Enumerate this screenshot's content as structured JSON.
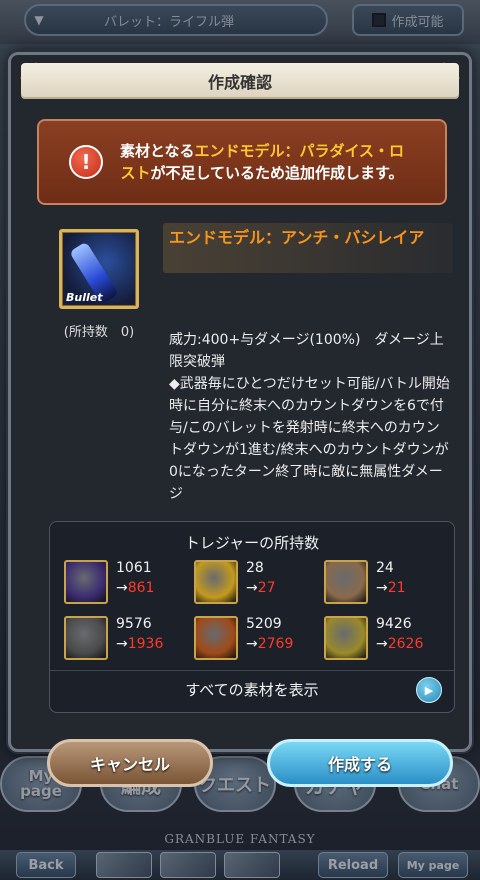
{
  "header": {
    "pallet_label": "バレット：ライフル弾",
    "craftable_label": "作成可能"
  },
  "dialog": {
    "title": "作成確認",
    "warning": {
      "prefix": "素材となる",
      "highlight": "エンドモデル：パラダイス・ロスト",
      "suffix": "が不足しているため追加作成します。"
    },
    "item": {
      "name": "エンドモデル：アンチ・バシレイア",
      "tag": "Bullet",
      "owned_label": "(所持数　0)",
      "description": "威力:400+与ダメージ(100%)　ダメージ上限突破弾\n◆武器毎にひとつだけセット可能/バトル開始時に自分に終末へのカウントダウンを6で付与/このバレットを発射時に終末へのカウントダウンが1進む/終末へのカウントダウンが0になったターン終了時に敵に無属性ダメージ"
    },
    "treasure": {
      "title": "トレジャーの所持数",
      "items": [
        {
          "icon": "dark-orb-icon",
          "have": "1061",
          "after": "861",
          "color": "#3b2b70"
        },
        {
          "icon": "gold-bar-icon",
          "have": "28",
          "after": "27",
          "color": "#c49a1e"
        },
        {
          "icon": "hourglass-icon",
          "have": "24",
          "after": "21",
          "color": "#8a6a4a"
        },
        {
          "icon": "silver-ore-icon",
          "have": "9576",
          "after": "1936",
          "color": "#4a4a4a"
        },
        {
          "icon": "treasure-chest-icon",
          "have": "5209",
          "after": "2769",
          "color": "#a04a18"
        },
        {
          "icon": "golden-chest-icon",
          "have": "9426",
          "after": "2626",
          "color": "#9a8a2a"
        }
      ],
      "arrow": "→",
      "show_all_label": "すべての素材を表示"
    },
    "cancel_label": "キャンセル",
    "craft_label": "作成する"
  },
  "background_nav": {
    "mypage": "My\npage",
    "party": "編成",
    "quest": "クエスト",
    "gacha": "ガチャ",
    "chat": "Chat"
  },
  "logo_text": "GRANBLUE FANTASY",
  "bottom_bar": {
    "back_label": "Back",
    "reload_label": "Reload",
    "mypage_label": "My page"
  }
}
